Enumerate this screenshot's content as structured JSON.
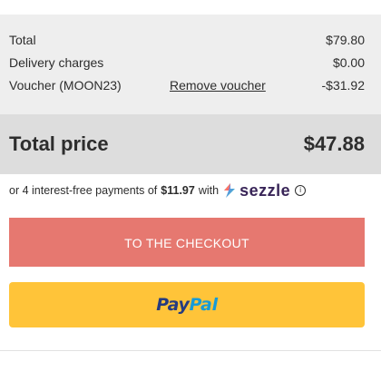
{
  "summary": {
    "rows": [
      {
        "label": "Total",
        "value": "$79.80"
      },
      {
        "label": "Delivery charges",
        "value": "$0.00"
      },
      {
        "label": "Voucher (MOON23)",
        "value": "-$31.92",
        "action": "Remove voucher"
      }
    ]
  },
  "total_price": {
    "label": "Total price",
    "value": "$47.88"
  },
  "installments": {
    "prefix": "or 4 interest-free payments of",
    "amount": "$11.97",
    "suffix": "with",
    "provider": "sezzle",
    "provider_icon": "sezzle-logo-icon",
    "info_icon": "info-icon"
  },
  "buttons": {
    "checkout_label": "TO THE CHECKOUT",
    "paypal_pay": "Pay",
    "paypal_pal": "Pal"
  },
  "colors": {
    "checkout_bg": "#e67870",
    "paypal_bg": "#ffc439",
    "paypal_dark": "#253b80",
    "paypal_light": "#179bd7",
    "sezzle_purple": "#392558"
  }
}
